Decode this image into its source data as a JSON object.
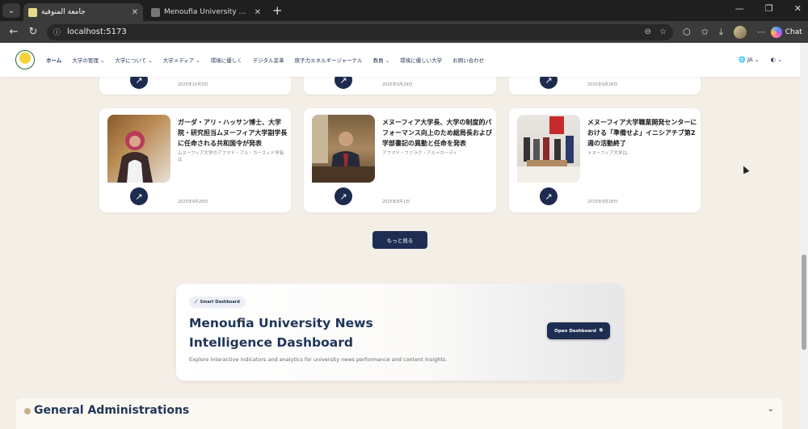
{
  "browser": {
    "tabs": [
      {
        "title": "جامعة المنوفية",
        "active": true
      },
      {
        "title": "Menoufia University News Intellige",
        "active": false
      }
    ],
    "url": "localhost:5173",
    "chat_label": "Chat"
  },
  "header": {
    "nav": [
      "ホーム",
      "大学の管理",
      "大学について",
      "大学メディア",
      "環境に優しく",
      "デジタル変革",
      "原子力エネルギージャーナル",
      "教員",
      "環境に優しい大学",
      "お問い合わせ"
    ],
    "lang": "JA"
  },
  "top_cards": [
    {
      "date": "2025年10月3日"
    },
    {
      "date": "2025年9月29日"
    },
    {
      "date": "2025年9月28日"
    }
  ],
  "cards": [
    {
      "title": "ガーダ・アリ・ハッサン博士、大学院・研究担当ムヌーフィア大学副学長に任命される共和国令が発表",
      "excerpt": "ムヌーフィア大学のアフマド・アル・カースィド学長は",
      "date": "2025年9月28日"
    },
    {
      "title": "メヌーフィア大学長、大学の制度的パフォーマンス向上のため総局長および学部書記の異動と任命を発表",
      "excerpt": "アフマド・ファラグ・アル＝カーディ",
      "date": "2025年9月1日"
    },
    {
      "title": "メヌーフィア大学職業開発センターにおける「準備せよ」イニシアチブ第2週の活動終了",
      "excerpt": "メヌーフィア大学は、",
      "date": "2025年9月28日"
    }
  ],
  "more_button": "もっと見る",
  "dashboard": {
    "badge": "Smart Dashboard",
    "title": "Menoufia University News Intelligence Dashboard",
    "subtitle": "Explore interactive indicators and analytics for university news performance and content insights.",
    "button": "Open Dashboard"
  },
  "accordion": {
    "title": "General Administrations"
  },
  "colors": {
    "navy": "#1e2e52",
    "cream": "#f3efe6",
    "title_blue": "#1f3557"
  }
}
